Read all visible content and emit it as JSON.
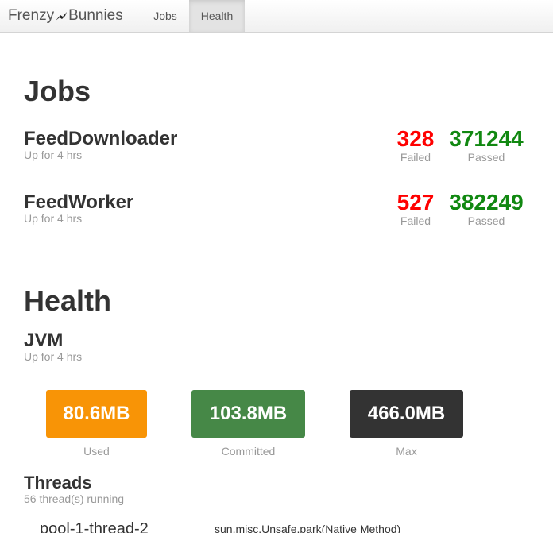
{
  "navbar": {
    "brand_left": "Frenzy",
    "brand_right": "Bunnies",
    "items": [
      {
        "label": "Jobs",
        "active": false
      },
      {
        "label": "Health",
        "active": true
      }
    ]
  },
  "jobs_section": {
    "title": "Jobs",
    "jobs": [
      {
        "name": "FeedDownloader",
        "uptime": "Up for 4 hrs",
        "failed": "328",
        "failed_label": "Failed",
        "passed": "371244",
        "passed_label": "Passed"
      },
      {
        "name": "FeedWorker",
        "uptime": "Up for 4 hrs",
        "failed": "527",
        "failed_label": "Failed",
        "passed": "382249",
        "passed_label": "Passed"
      }
    ]
  },
  "health_section": {
    "title": "Health",
    "jvm": {
      "title": "JVM",
      "uptime": "Up for 4 hrs",
      "memory": [
        {
          "value": "80.6MB",
          "label": "Used",
          "color": "#f89406"
        },
        {
          "value": "103.8MB",
          "label": "Committed",
          "color": "#468847"
        },
        {
          "value": "466.0MB",
          "label": "Max",
          "color": "#333333"
        }
      ]
    },
    "threads": {
      "title": "Threads",
      "summary": "56 thread(s) running",
      "rows": [
        {
          "name": "pool-1-thread-2",
          "frame": "sun.misc.Unsafe.park(Native Method)"
        }
      ]
    }
  },
  "colors": {
    "failed": "#ff0000",
    "passed": "#118811",
    "muted": "#999999"
  }
}
